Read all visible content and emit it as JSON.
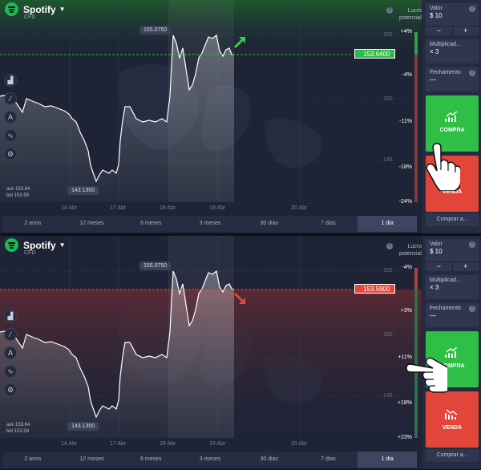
{
  "panels": [
    {
      "asset_name": "Spotify",
      "asset_type": "CFD",
      "lucro_label": "Lucro potencial",
      "lucro_help": "?",
      "profit_labels": [
        "+4%",
        "-4%",
        "-11%",
        "-18%",
        "-24%"
      ],
      "price_labels": [
        "155",
        "150",
        "145"
      ],
      "current_price": "153.6400",
      "high_tooltip": "155.0750",
      "low_tooltip": "143.1300",
      "ask": "ask 153.64",
      "bid": "bid 153.59",
      "direction": "up",
      "accent_color": "#33b94a",
      "cursor_target": "compra"
    },
    {
      "asset_name": "Spotify",
      "asset_type": "CFD",
      "lucro_label": "Lucro potencial",
      "lucro_help": "?",
      "profit_labels": [
        "-4%",
        "+3%",
        "+11%",
        "+18%",
        "+23%"
      ],
      "price_labels": [
        "155",
        "150",
        "145"
      ],
      "current_price": "153.5900",
      "high_tooltip": "155.0750",
      "low_tooltip": "143.1300",
      "ask": "ask 153.64",
      "bid": "bid 153.59",
      "direction": "down",
      "accent_color": "#e2493a",
      "cursor_target": "venda"
    }
  ],
  "x_axis": [
    "14 Abr",
    "17 Abr",
    "18 Abr",
    "19 Abr",
    "20 Abr"
  ],
  "timeframes": [
    "2 anos",
    "12 meses",
    "6 meses",
    "3 meses",
    "30 dias",
    "7 dias",
    "1 dia"
  ],
  "active_timeframe": "1 dia",
  "sidebar": {
    "valor_label": "Valor",
    "valor_value": "$ 10",
    "mult_label": "Multiplicad...",
    "mult_value": "× 3",
    "fech_label": "Fechamento",
    "fech_value": "—",
    "help": "?",
    "minus": "−",
    "plus": "+",
    "buy_label": "COMPRA",
    "sell_label": "VENDA",
    "comprar_a": "Comprar a..."
  },
  "icons": [
    "spotify-logo",
    "chevron-down-icon",
    "area-chart-icon",
    "drawing-icon",
    "indicators-icon",
    "settings-icon",
    "trend-up-icon",
    "trend-down-icon",
    "hand-cursor-icon"
  ]
}
